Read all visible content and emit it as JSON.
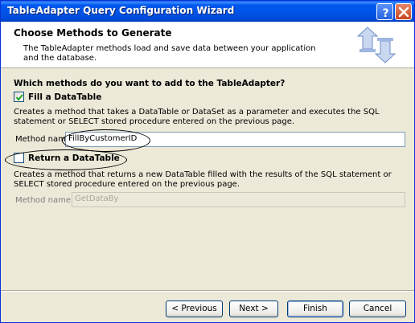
{
  "window": {
    "title": "TableAdapter Query Configuration Wizard"
  },
  "title_buttons": {
    "help_icon": "question-mark-icon",
    "close_icon": "close-x-icon"
  },
  "header": {
    "title": "Choose Methods to Generate",
    "description": "The TableAdapter methods load and save data between your application and the database.",
    "icon": "database-sync-arrows-icon"
  },
  "body": {
    "question": "Which methods do you want to add to the TableAdapter?",
    "fill": {
      "checked": true,
      "label": "Fill a DataTable",
      "description": "Creates a method that takes a DataTable or DataSet as a parameter and executes the SQL statement or SELECT stored procedure entered on the previous page.",
      "method_label": "Method name:",
      "method_value": "FillByCustomerID"
    },
    "return": {
      "checked": false,
      "label": "Return a DataTable",
      "description": "Creates a method that returns a new DataTable filled with the results of the SQL statement or SELECT stored procedure entered on the previous page.",
      "method_label": "Method name:",
      "method_value": "GetDataBy"
    }
  },
  "footer": {
    "previous": "< Previous",
    "next": "Next >",
    "finish": "Finish",
    "cancel": "Cancel"
  },
  "colors": {
    "titlebar": "#0054e3",
    "dialog_bg": "#ece9d8",
    "header_bg": "#ffffff",
    "checkbox_check": "#21a121"
  }
}
